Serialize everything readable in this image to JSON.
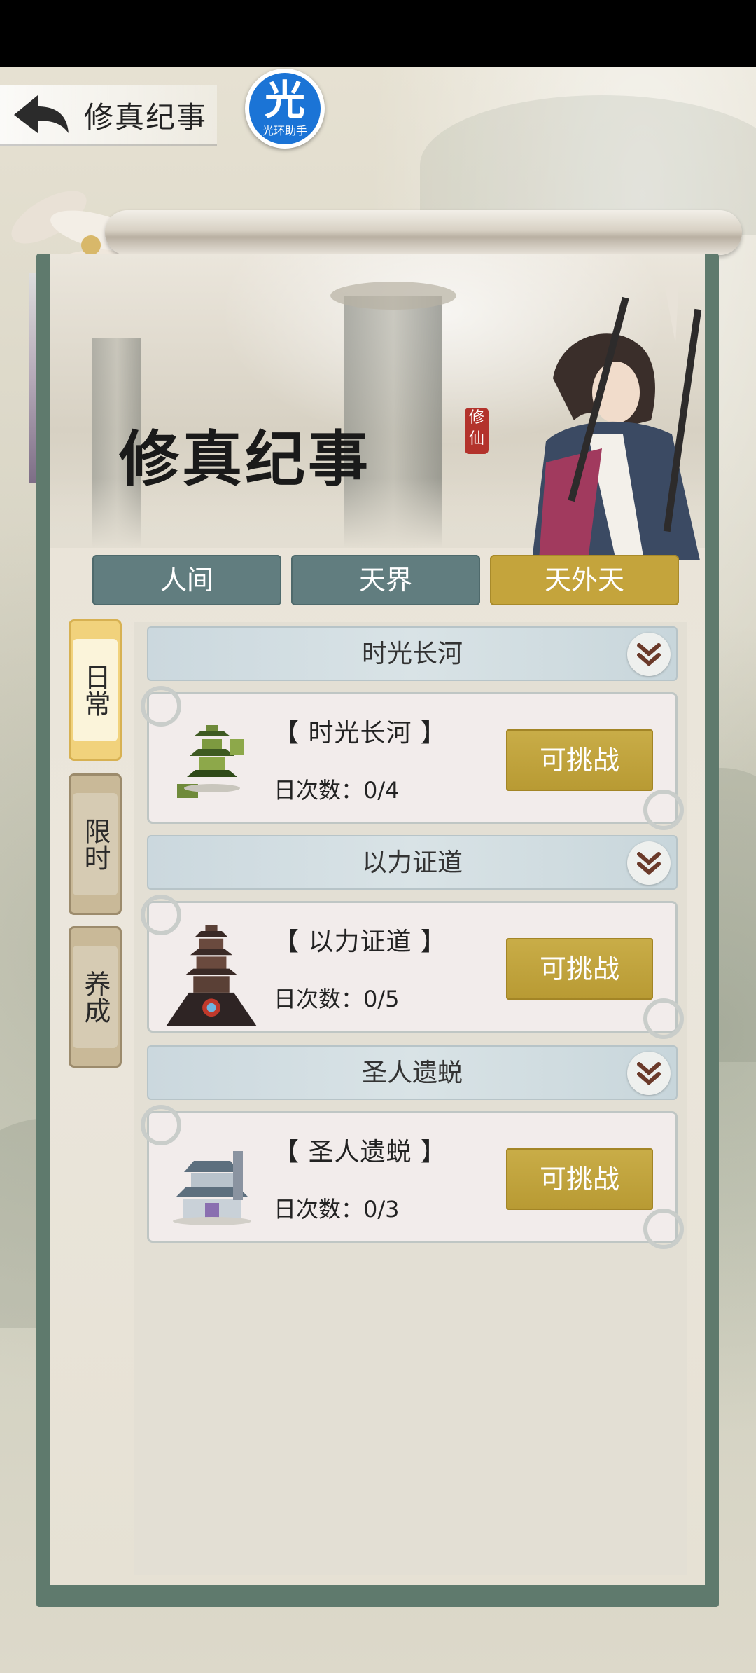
{
  "header": {
    "title": "修真纪事"
  },
  "logo": {
    "char": "光",
    "sub": "光环助手"
  },
  "banner": {
    "title": "修真纪事",
    "seal": "修仙"
  },
  "tabs": [
    {
      "label": "人间",
      "active": false
    },
    {
      "label": "天界",
      "active": false
    },
    {
      "label": "天外天",
      "active": true
    }
  ],
  "side_tabs": [
    {
      "label": "日常",
      "active": true
    },
    {
      "label": "限时",
      "active": false
    },
    {
      "label": "养成",
      "active": false
    }
  ],
  "sections": [
    {
      "header": "时光长河",
      "card_title": "【 时光长河 】",
      "count": "日次数：0/4",
      "button": "可挑战",
      "icon": "pagoda-floating-icon"
    },
    {
      "header": "以力证道",
      "card_title": "【 以力证道 】",
      "count": "日次数：0/5",
      "button": "可挑战",
      "icon": "dark-tower-icon"
    },
    {
      "header": "圣人遗蜕",
      "card_title": "【 圣人遗蜕 】",
      "count": "日次数：0/3",
      "button": "可挑战",
      "icon": "palace-icon"
    }
  ],
  "colors": {
    "tab_normal": "#617d7f",
    "tab_active": "#c4a43c",
    "button": "#c4a43c",
    "frame": "#5f7a6d"
  }
}
